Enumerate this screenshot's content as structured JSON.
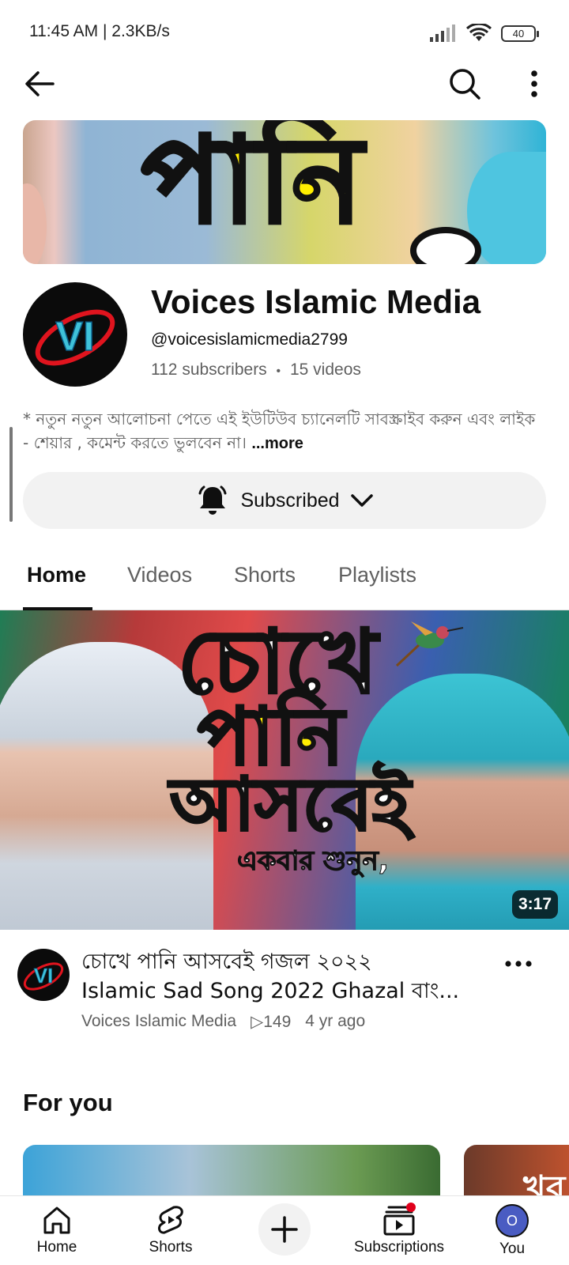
{
  "status_bar": {
    "time": "11:45 AM | 2.3KB/s",
    "battery": "40"
  },
  "banner": {
    "text": "পানি"
  },
  "channel": {
    "avatar_text": "VI",
    "name": "Voices Islamic Media",
    "handle": "@voicesislamicmedia2799",
    "subscribers": "112 subscribers",
    "separator": "•",
    "videos": "15 videos",
    "description": "* নতুন নতুন আলোচনা পেতে এই ইউটিউব চ্যানেলটি সাবস্ক্রাইব করুন এবং লাইক - শেয়ার , কমেন্ট করতে ভুলবেন না। ",
    "more_label": "...more",
    "subscribe_label": "Subscribed"
  },
  "tabs": [
    {
      "label": "Home",
      "active": true
    },
    {
      "label": "Videos",
      "active": false
    },
    {
      "label": "Shorts",
      "active": false
    },
    {
      "label": "Playlists",
      "active": false
    }
  ],
  "featured_video": {
    "thumbnail_lines": [
      "চোখে",
      "পানি",
      "আসবেই",
      "একবার শুনুন,"
    ],
    "duration": "3:17",
    "title_line1": "চোখে পানি আসবেই   গজল ২০২২",
    "title_line2": "Islamic Sad Song 2022   Ghazal   বাং...",
    "channel": "Voices Islamic Media",
    "views": "▷149",
    "age": "4 yr ago"
  },
  "for_you": {
    "title": "For you",
    "card2_text": "খব"
  },
  "bottom_nav": {
    "home": "Home",
    "shorts": "Shorts",
    "subscriptions": "Subscriptions",
    "you": "You",
    "you_avatar": "O"
  }
}
